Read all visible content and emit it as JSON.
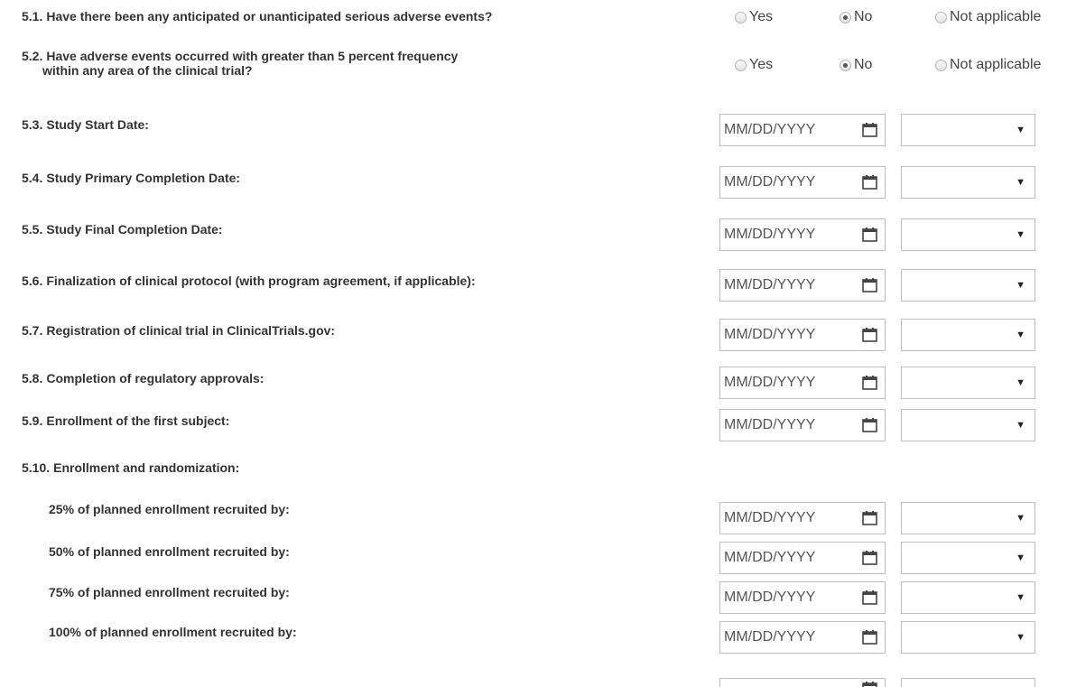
{
  "questions": {
    "q5_1": {
      "number": "5.1.",
      "text": "Have there been any anticipated or unanticipated serious adverse events?"
    },
    "q5_2": {
      "number": "5.2.",
      "line1": "Have adverse events occurred with greater than 5 percent frequency",
      "line2": "within any area of the clinical trial?"
    }
  },
  "radio_options": {
    "yes": "Yes",
    "no": "No",
    "na": "Not applicable"
  },
  "radio_selected": {
    "q5_1": "No",
    "q5_2": "No"
  },
  "date_rows": [
    {
      "number": "5.3.",
      "label": "Study Start Date:"
    },
    {
      "number": "5.4.",
      "label": "Study Primary Completion Date:"
    },
    {
      "number": "5.5.",
      "label": "Study Final Completion Date:"
    },
    {
      "number": "5.6.",
      "label": "Finalization of clinical protocol (with program agreement, if applicable):"
    },
    {
      "number": "5.7.",
      "label": "Registration of clinical trial in ClinicalTrials.gov:"
    },
    {
      "number": "5.8.",
      "label": "Completion of regulatory approvals:"
    },
    {
      "number": "5.9.",
      "label": "Enrollment of the first subject:"
    }
  ],
  "enrollment": {
    "number": "5.10.",
    "label": "Enrollment and randomization:",
    "items": [
      {
        "label": "25% of planned enrollment recruited by:"
      },
      {
        "label": "50% of planned enrollment recruited by:"
      },
      {
        "label": "75% of planned enrollment recruited by:"
      },
      {
        "label": "100% of planned enrollment recruited by:"
      }
    ]
  },
  "date_placeholder": "MM/DD/YYYY",
  "icons": {
    "calendar": "calendar-icon",
    "dropdown": "chevron-down-icon"
  },
  "colors": {
    "border": "#bdbdbd",
    "text": "#333333",
    "radio_dot": "#555555"
  }
}
